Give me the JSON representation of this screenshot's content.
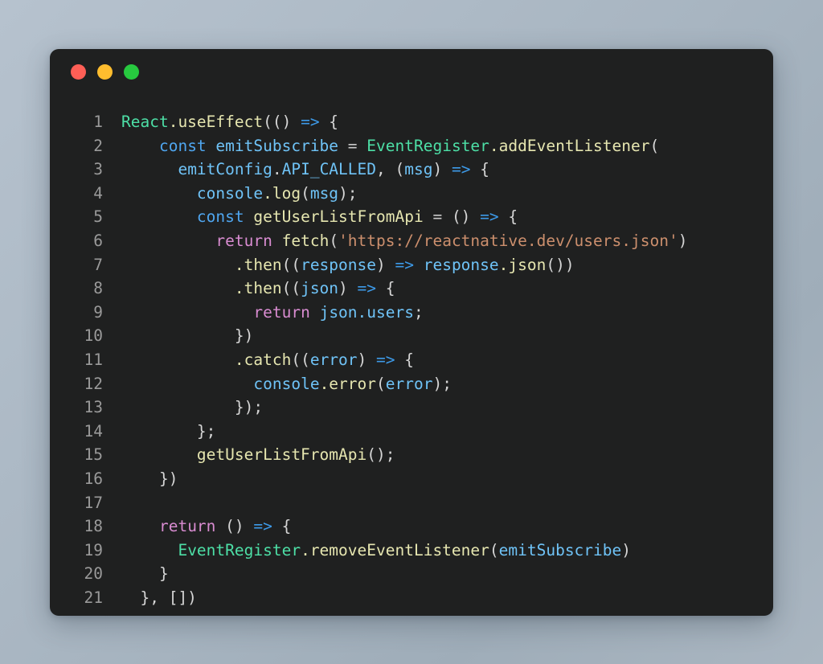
{
  "window": {
    "title": "Code Snippet",
    "background_start": "#b6c2ce",
    "background_end": "#9fadb9",
    "panel_bg": "#1f2020",
    "traffic_lights": [
      {
        "name": "close-dot",
        "color": "#ff5f56"
      },
      {
        "name": "minimize-dot",
        "color": "#ffbd2e"
      },
      {
        "name": "maximize-dot",
        "color": "#27c93f"
      }
    ]
  },
  "editor": {
    "language": "javascript",
    "gutter_color": "#9a9a9a",
    "line_numbers": [
      "1",
      "2",
      "3",
      "4",
      "5",
      "6",
      "7",
      "8",
      "9",
      "10",
      "11",
      "12",
      "13",
      "14",
      "15",
      "16",
      "17",
      "18",
      "19",
      "20",
      "21"
    ],
    "colors": {
      "keyword": "#4fa6f0",
      "variable": "#6fc3f7",
      "class": "#4ddfa6",
      "function": "#e6e6b0",
      "string": "#cc8f6d",
      "return": "#d98cd1",
      "arrow": "#3d9ae8",
      "plain": "#e3e3e3"
    },
    "plain_text": "React.useEffect(() => {\n    const emitSubscribe = EventRegister.addEventListener(\n      emitConfig.API_CALLED, (msg) => {\n        console.log(msg);\n        const getUserListFromApi = () => {\n          return fetch('https://reactnative.dev/users.json')\n            .then((response) => response.json())\n            .then((json) => {\n              return json.users;\n            })\n            .catch((error) => {\n              console.error(error);\n            });\n        };\n        getUserListFromApi();\n    })\n\n    return () => {\n      EventRegister.removeEventListener(emitSubscribe)\n    }\n  }, [])",
    "lines": [
      {
        "n": "1",
        "tokens": [
          {
            "t": "React",
            "c": "class"
          },
          {
            "t": ".useEffect",
            "c": "fn"
          },
          {
            "t": "((",
            "c": "punct"
          },
          {
            "t": ") ",
            "c": "punct"
          },
          {
            "t": "=>",
            "c": "arrow"
          },
          {
            "t": " {",
            "c": "punct"
          }
        ]
      },
      {
        "n": "2",
        "tokens": [
          {
            "t": "    ",
            "c": "plain"
          },
          {
            "t": "const",
            "c": "kw"
          },
          {
            "t": " ",
            "c": "plain"
          },
          {
            "t": "emitSubscribe",
            "c": "var"
          },
          {
            "t": " ",
            "c": "plain"
          },
          {
            "t": "=",
            "c": "op"
          },
          {
            "t": " ",
            "c": "plain"
          },
          {
            "t": "EventRegister",
            "c": "class"
          },
          {
            "t": ".addEventListener",
            "c": "fn"
          },
          {
            "t": "(",
            "c": "punct"
          }
        ]
      },
      {
        "n": "3",
        "tokens": [
          {
            "t": "      ",
            "c": "plain"
          },
          {
            "t": "emitConfig",
            "c": "var"
          },
          {
            "t": ".",
            "c": "punct"
          },
          {
            "t": "API_CALLED",
            "c": "var"
          },
          {
            "t": ", (",
            "c": "punct"
          },
          {
            "t": "msg",
            "c": "var"
          },
          {
            "t": ") ",
            "c": "punct"
          },
          {
            "t": "=>",
            "c": "arrow"
          },
          {
            "t": " {",
            "c": "punct"
          }
        ]
      },
      {
        "n": "4",
        "tokens": [
          {
            "t": "        ",
            "c": "plain"
          },
          {
            "t": "console",
            "c": "var"
          },
          {
            "t": ".log",
            "c": "fn"
          },
          {
            "t": "(",
            "c": "punct"
          },
          {
            "t": "msg",
            "c": "var"
          },
          {
            "t": ");",
            "c": "punct"
          }
        ]
      },
      {
        "n": "5",
        "tokens": [
          {
            "t": "        ",
            "c": "plain"
          },
          {
            "t": "const",
            "c": "kw"
          },
          {
            "t": " ",
            "c": "plain"
          },
          {
            "t": "getUserListFromApi",
            "c": "fn"
          },
          {
            "t": " ",
            "c": "plain"
          },
          {
            "t": "=",
            "c": "op"
          },
          {
            "t": " () ",
            "c": "punct"
          },
          {
            "t": "=>",
            "c": "arrow"
          },
          {
            "t": " {",
            "c": "punct"
          }
        ]
      },
      {
        "n": "6",
        "tokens": [
          {
            "t": "          ",
            "c": "plain"
          },
          {
            "t": "return",
            "c": "ret"
          },
          {
            "t": " ",
            "c": "plain"
          },
          {
            "t": "fetch",
            "c": "fn"
          },
          {
            "t": "(",
            "c": "punct"
          },
          {
            "t": "'https://reactnative.dev/users.json'",
            "c": "str"
          },
          {
            "t": ")",
            "c": "punct"
          }
        ]
      },
      {
        "n": "7",
        "tokens": [
          {
            "t": "            ",
            "c": "plain"
          },
          {
            "t": ".then",
            "c": "fn"
          },
          {
            "t": "((",
            "c": "punct"
          },
          {
            "t": "response",
            "c": "var"
          },
          {
            "t": ") ",
            "c": "punct"
          },
          {
            "t": "=>",
            "c": "arrow"
          },
          {
            "t": " ",
            "c": "plain"
          },
          {
            "t": "response",
            "c": "var"
          },
          {
            "t": ".json",
            "c": "fn"
          },
          {
            "t": "())",
            "c": "punct"
          }
        ]
      },
      {
        "n": "8",
        "tokens": [
          {
            "t": "            ",
            "c": "plain"
          },
          {
            "t": ".then",
            "c": "fn"
          },
          {
            "t": "((",
            "c": "punct"
          },
          {
            "t": "json",
            "c": "var"
          },
          {
            "t": ") ",
            "c": "punct"
          },
          {
            "t": "=>",
            "c": "arrow"
          },
          {
            "t": " {",
            "c": "punct"
          }
        ]
      },
      {
        "n": "9",
        "tokens": [
          {
            "t": "              ",
            "c": "plain"
          },
          {
            "t": "return",
            "c": "ret"
          },
          {
            "t": " ",
            "c": "plain"
          },
          {
            "t": "json",
            "c": "var"
          },
          {
            "t": ".users",
            "c": "var"
          },
          {
            "t": ";",
            "c": "punct"
          }
        ]
      },
      {
        "n": "10",
        "tokens": [
          {
            "t": "            })",
            "c": "punct"
          }
        ]
      },
      {
        "n": "11",
        "tokens": [
          {
            "t": "            ",
            "c": "plain"
          },
          {
            "t": ".catch",
            "c": "fn"
          },
          {
            "t": "((",
            "c": "punct"
          },
          {
            "t": "error",
            "c": "var"
          },
          {
            "t": ") ",
            "c": "punct"
          },
          {
            "t": "=>",
            "c": "arrow"
          },
          {
            "t": " {",
            "c": "punct"
          }
        ]
      },
      {
        "n": "12",
        "tokens": [
          {
            "t": "              ",
            "c": "plain"
          },
          {
            "t": "console",
            "c": "var"
          },
          {
            "t": ".error",
            "c": "fn"
          },
          {
            "t": "(",
            "c": "punct"
          },
          {
            "t": "error",
            "c": "var"
          },
          {
            "t": ");",
            "c": "punct"
          }
        ]
      },
      {
        "n": "13",
        "tokens": [
          {
            "t": "            });",
            "c": "punct"
          }
        ]
      },
      {
        "n": "14",
        "tokens": [
          {
            "t": "        };",
            "c": "punct"
          }
        ]
      },
      {
        "n": "15",
        "tokens": [
          {
            "t": "        ",
            "c": "plain"
          },
          {
            "t": "getUserListFromApi",
            "c": "fn"
          },
          {
            "t": "();",
            "c": "punct"
          }
        ]
      },
      {
        "n": "16",
        "tokens": [
          {
            "t": "    })",
            "c": "punct"
          }
        ]
      },
      {
        "n": "17",
        "tokens": [
          {
            "t": "",
            "c": "plain"
          }
        ]
      },
      {
        "n": "18",
        "tokens": [
          {
            "t": "    ",
            "c": "plain"
          },
          {
            "t": "return",
            "c": "ret"
          },
          {
            "t": " () ",
            "c": "punct"
          },
          {
            "t": "=>",
            "c": "arrow"
          },
          {
            "t": " {",
            "c": "punct"
          }
        ]
      },
      {
        "n": "19",
        "tokens": [
          {
            "t": "      ",
            "c": "plain"
          },
          {
            "t": "EventRegister",
            "c": "class"
          },
          {
            "t": ".removeEventListener",
            "c": "fn"
          },
          {
            "t": "(",
            "c": "punct"
          },
          {
            "t": "emitSubscribe",
            "c": "var"
          },
          {
            "t": ")",
            "c": "punct"
          }
        ]
      },
      {
        "n": "20",
        "tokens": [
          {
            "t": "    }",
            "c": "punct"
          }
        ]
      },
      {
        "n": "21",
        "tokens": [
          {
            "t": "  }, [])",
            "c": "punct"
          }
        ]
      }
    ]
  }
}
